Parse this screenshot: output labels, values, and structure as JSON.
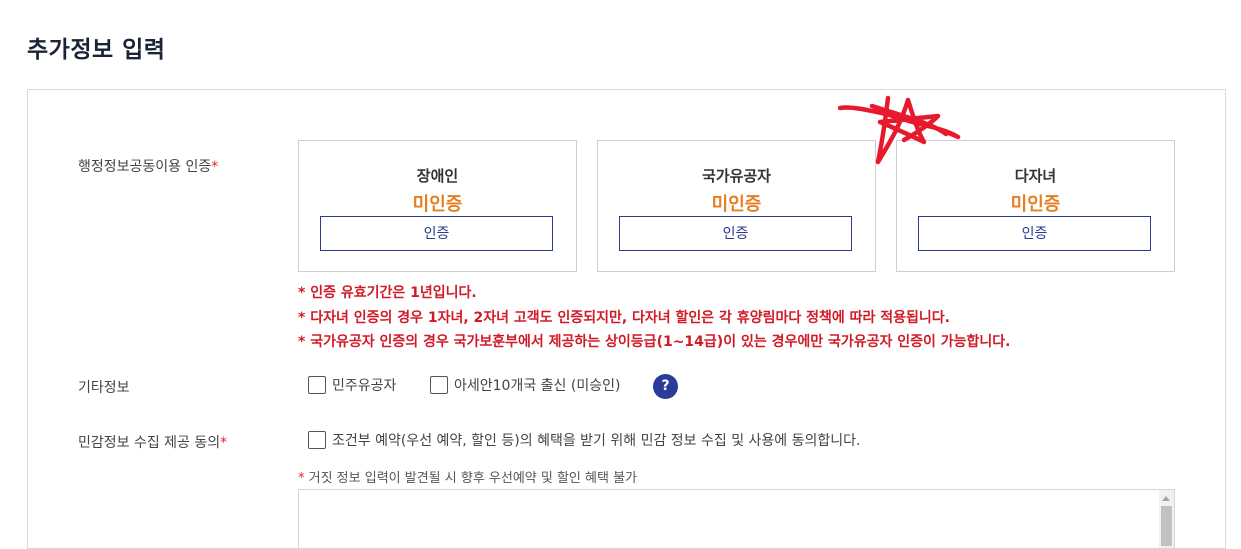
{
  "page_title": "추가정보 입력",
  "admin_cert": {
    "label": "행정정보공동이용 인증",
    "required_mark": "*",
    "cards": [
      {
        "name": "장애인",
        "status": "미인증",
        "button": "인증"
      },
      {
        "name": "국가유공자",
        "status": "미인증",
        "button": "인증"
      },
      {
        "name": "다자녀",
        "status": "미인증",
        "button": "인증"
      }
    ],
    "notes": [
      "* 인증 유효기간은 1년입니다.",
      "* 다자녀 인증의 경우 1자녀, 2자녀 고객도 인증되지만, 다자녀 할인은 각 휴양림마다 정책에 따라 적용됩니다.",
      "* 국가유공자 인증의 경우 국가보훈부에서 제공하는 상이등급(1~14급)이 있는 경우에만 국가유공자 인증이 가능합니다."
    ]
  },
  "other_info": {
    "label": "기타정보",
    "options": [
      "민주유공자",
      "아세안10개국 출신 (미승인)"
    ],
    "help": "?"
  },
  "sensitive": {
    "label": "민감정보 수집 제공 동의",
    "required_mark": "*",
    "checkbox_label": "조건부 예약(우선 예약, 할인 등)의 혜택을 받기 위해 민감 정보 수집 및 사용에 동의합니다.",
    "warn_star": "*",
    "warning": " 거짓 정보 입력이 발견될 시 향후 우선예약 및 할인 혜택 불가"
  },
  "colors": {
    "status": "#e67e22",
    "notes": "#d21a26",
    "accent": "#2b3b8f",
    "scribble": "#e8192c"
  }
}
